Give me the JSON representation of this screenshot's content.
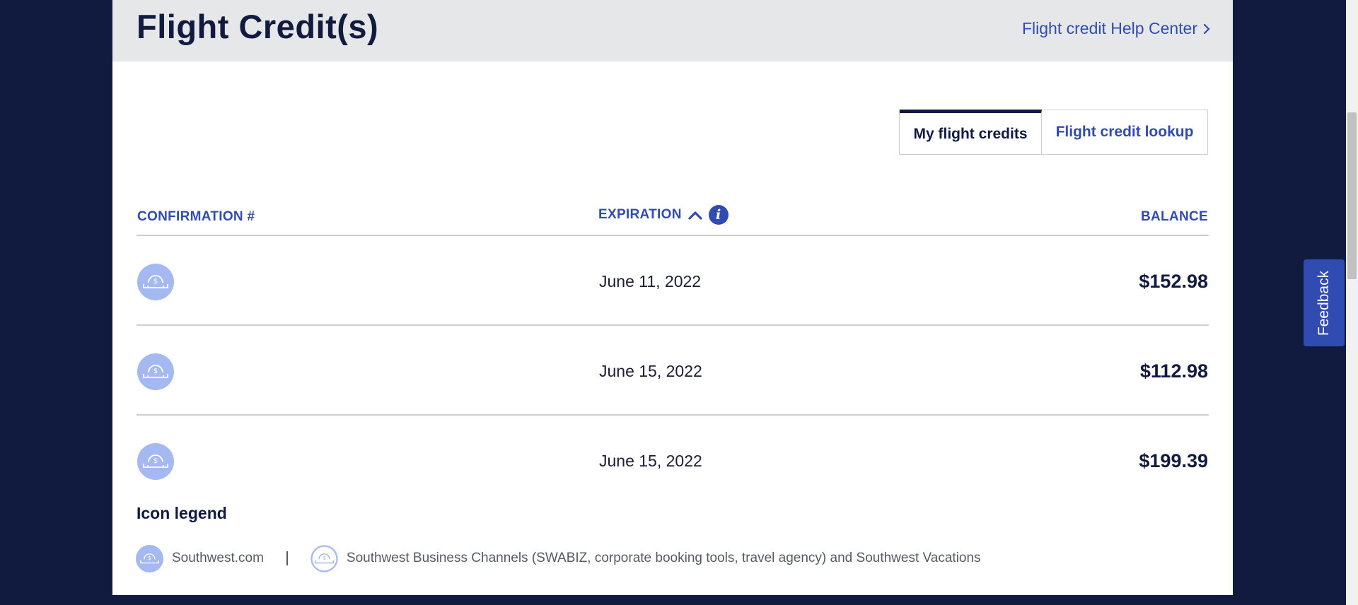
{
  "header": {
    "title": "Flight Credit(s)",
    "help_link": "Flight credit Help Center"
  },
  "tabs": [
    {
      "label": "My flight credits",
      "active": true
    },
    {
      "label": "Flight credit lookup",
      "active": false
    }
  ],
  "table": {
    "columns": {
      "confirmation": "CONFIRMATION #",
      "expiration": "EXPIRATION",
      "balance": "BALANCE"
    },
    "rows": [
      {
        "icon": "southwest-com-credit-icon",
        "expiration": "June 11, 2022",
        "balance": "$152.98"
      },
      {
        "icon": "southwest-com-credit-icon",
        "expiration": "June 15, 2022",
        "balance": "$112.98"
      },
      {
        "icon": "southwest-com-credit-icon",
        "expiration": "June 15, 2022",
        "balance": "$199.39"
      }
    ]
  },
  "legend": {
    "title": "Icon legend",
    "items": [
      {
        "icon": "southwest-com-credit-icon",
        "label": "Southwest.com"
      },
      {
        "icon": "business-channels-credit-icon",
        "label": "Southwest Business Channels (SWABIZ, corporate booking tools, travel agency) and Southwest Vacations"
      }
    ]
  },
  "feedback": {
    "label": "Feedback"
  },
  "colors": {
    "navy": "#111b40",
    "brand_blue": "#304cb2",
    "icon_blue": "#a4b9f2",
    "header_gray": "#e6e7e9"
  }
}
